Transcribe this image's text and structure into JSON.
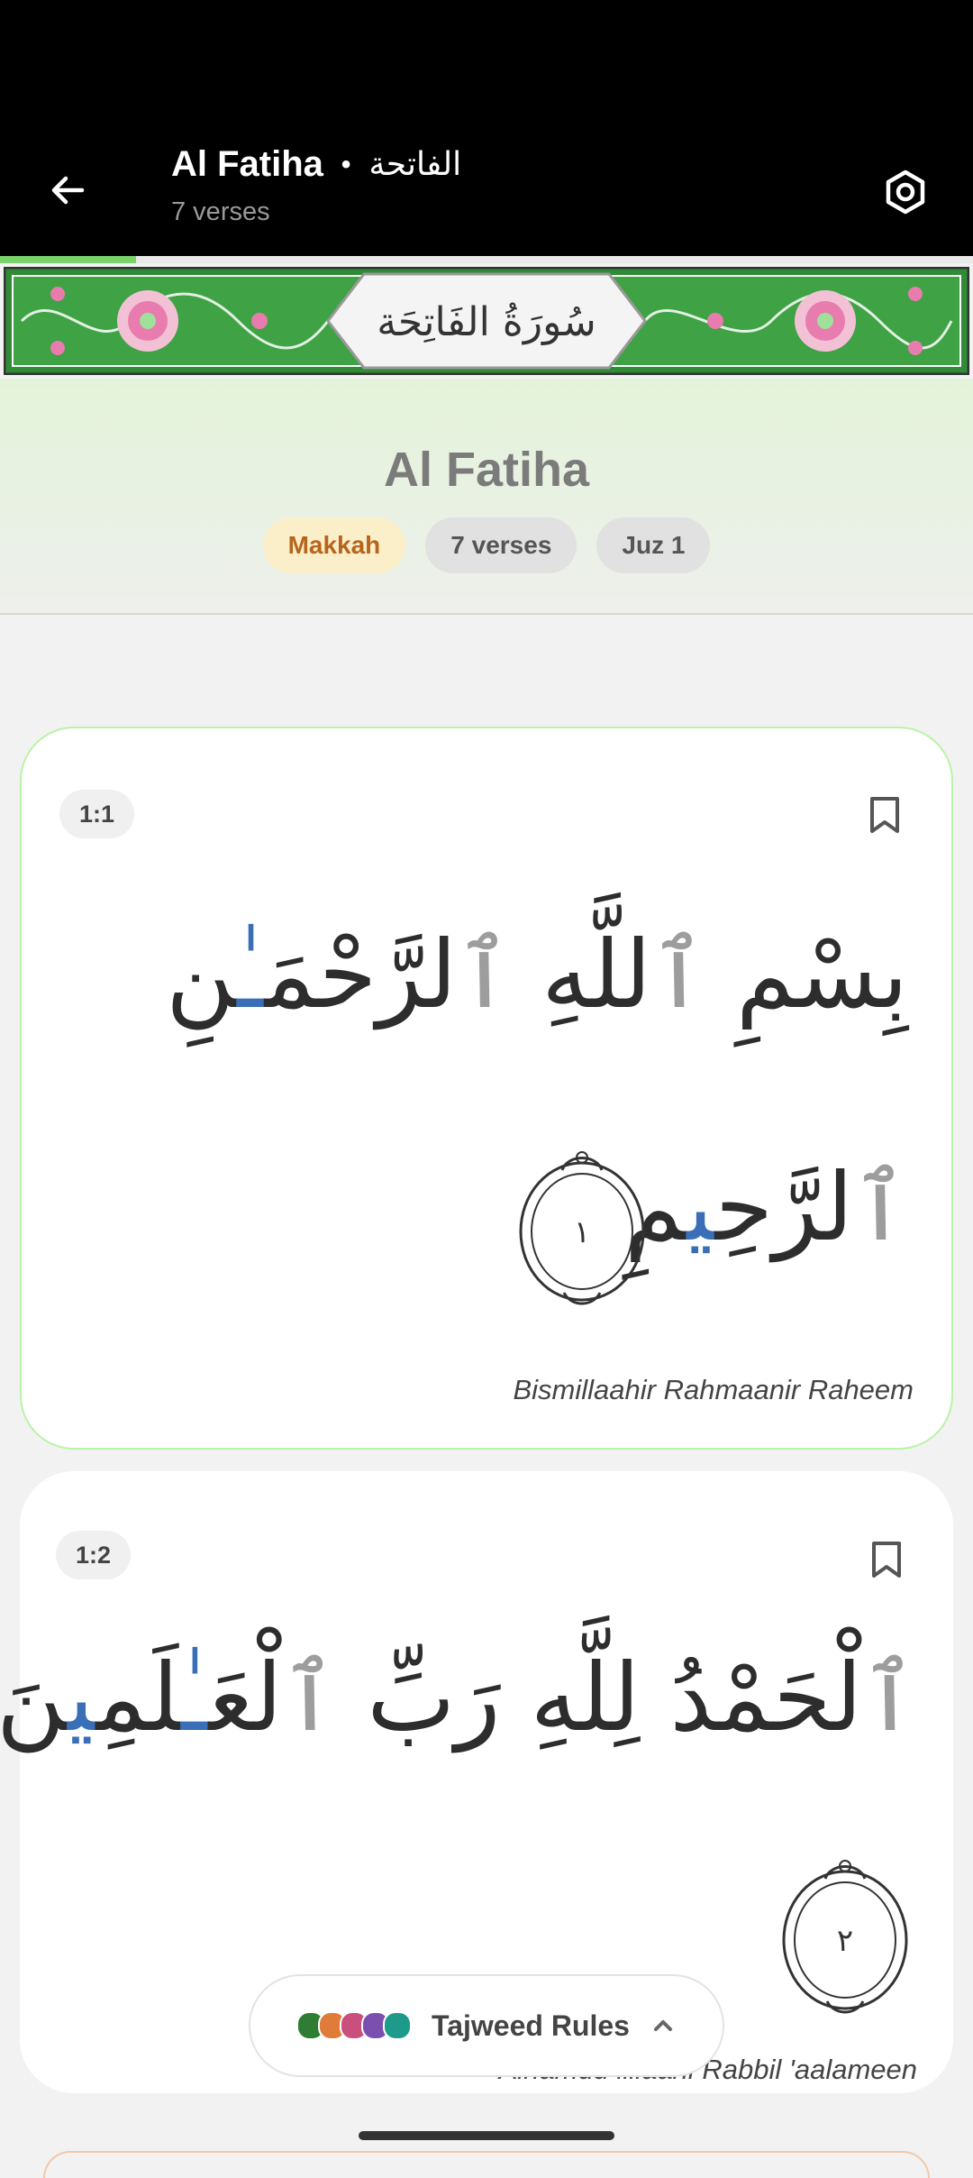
{
  "header": {
    "title": "Al Fatiha",
    "title_arabic": "الفاتحة",
    "separator": "•",
    "subtitle": "7 verses",
    "back_icon": "arrow-left-icon",
    "settings_icon": "hexagon-settings-icon"
  },
  "reading_progress": 0.14,
  "banner": {
    "calligraphy": "سُورَةُ الفَاتِحَة",
    "colors": {
      "frame": "#3a9a3a",
      "flower": "#e97cae"
    }
  },
  "surah_info": {
    "name": "Al Fatiha",
    "origin_chip": "Makkah",
    "verses_chip": "7 verses",
    "juz_chip": "Juz 1"
  },
  "verses": [
    {
      "key": "1:1",
      "arabic_line1": [
        "بِسْمِ ",
        "ٱ",
        "للَّهِ ",
        "ٱ",
        "لرَّحْمَ",
        "ـٰ",
        "نِ"
      ],
      "arabic_line2": [
        "ٱ",
        "لرَّحِ",
        "ي",
        "مِ"
      ],
      "ayah_number": "١",
      "transliteration": "Bismillaahir Rahmaanir Raheem"
    },
    {
      "key": "1:2",
      "arabic_line1": [
        "ٱ",
        "لْحَمْدُ لِلَّهِ رَبِّ ",
        "ٱ",
        "لْعَ",
        "ـٰ",
        "لَمِ",
        "ي",
        "نَ"
      ],
      "ayah_number": "٢",
      "transliteration": "Alhamdu lillaahi Rabbil 'aalameen"
    }
  ],
  "tajweed_button": {
    "label": "Tajweed Rules",
    "colors": [
      "#2e7d32",
      "#e07b39",
      "#c94f7c",
      "#7b4fb0",
      "#1e9a8a"
    ]
  },
  "theme": {
    "accent": "#7ad36a",
    "tajweed_blue": "#3a6fb8",
    "silent_gray": "#9d9d9d"
  }
}
